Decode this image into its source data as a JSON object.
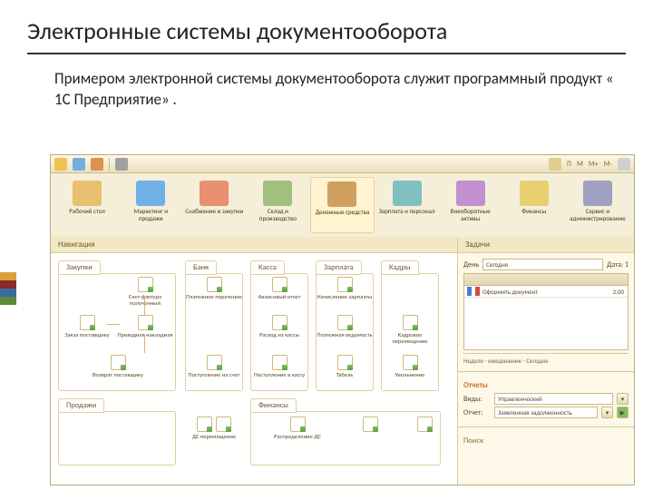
{
  "slide": {
    "title": "Электронные системы документооборота",
    "text": "Примером электронной системы документооборота служит программный продукт « 1С Предприятие» ."
  },
  "accent_colors": [
    "#d9a03a",
    "#8a2a2a",
    "#3a6aa0",
    "#5a8a3a"
  ],
  "toolbar": {
    "right_labels": [
      "П",
      "М",
      "М+",
      "М-"
    ]
  },
  "tabs": [
    {
      "label": "Рабочий стол",
      "color": "#e8c070",
      "active": false
    },
    {
      "label": "Маркетинг и продажи",
      "color": "#70b0e8",
      "active": false
    },
    {
      "label": "Снабжение и закупки",
      "color": "#e89070",
      "active": false
    },
    {
      "label": "Склад и производство",
      "color": "#a0c080",
      "active": false
    },
    {
      "label": "Денежные средства",
      "color": "#d0a060",
      "active": true
    },
    {
      "label": "Зарплата и персонал",
      "color": "#80c0c0",
      "active": false
    },
    {
      "label": "Внеоборотные активы",
      "color": "#c090d0",
      "active": false
    },
    {
      "label": "Финансы",
      "color": "#e8d070",
      "active": false
    },
    {
      "label": "Сервис и администрирование",
      "color": "#a0a0c0",
      "active": false
    }
  ],
  "nav_header": "Навигация",
  "sections": {
    "zakupki": "Закупки",
    "bank": "Банк",
    "kassa": "Касса",
    "zarplata": "Зарплата",
    "kadry": "Кадры",
    "prodazhi": "Продажи",
    "finansy": "Финансы"
  },
  "procs": {
    "schet_faktura": "Счет-фактура полученный",
    "zakaz_post": "Заказ поставщику",
    "prihodnaya": "Приходная накладная",
    "vozvrat_post": "Возврат поставщику",
    "platezhnoe": "Платежное поручение",
    "postuplenie_rs": "Поступление на счет",
    "avansovyj": "Авансовый отчет",
    "rashod_kassy": "Расход из кассы",
    "postuplenie_kassu": "Поступление в кассу",
    "nachislenie": "Начисление зарплаты",
    "platezhnaya_ved": "Платежная ведомость",
    "tabel": "Табель",
    "kadrovoe": "Кадровое перемещение",
    "uvolnenie": "Увольнение",
    "ds_peremeshch": "ДС перемещение",
    "raspredelenie": "Распределение ДС"
  },
  "side": {
    "tasks_header": "Задачи",
    "date_label": "День",
    "date_value": "Сегодня",
    "date_range": "Дата: 1",
    "task_item": "Оформить документ",
    "task_time": "2.00",
    "events_label": "Неделя - ежедневник - Сегодня",
    "reports_header": "Отчеты",
    "vid_label": "Виды:",
    "vid_value": "Управленческий",
    "report_label": "Отчет:",
    "report_value": "Заявленная задолженность",
    "search_header": "Поиск"
  }
}
